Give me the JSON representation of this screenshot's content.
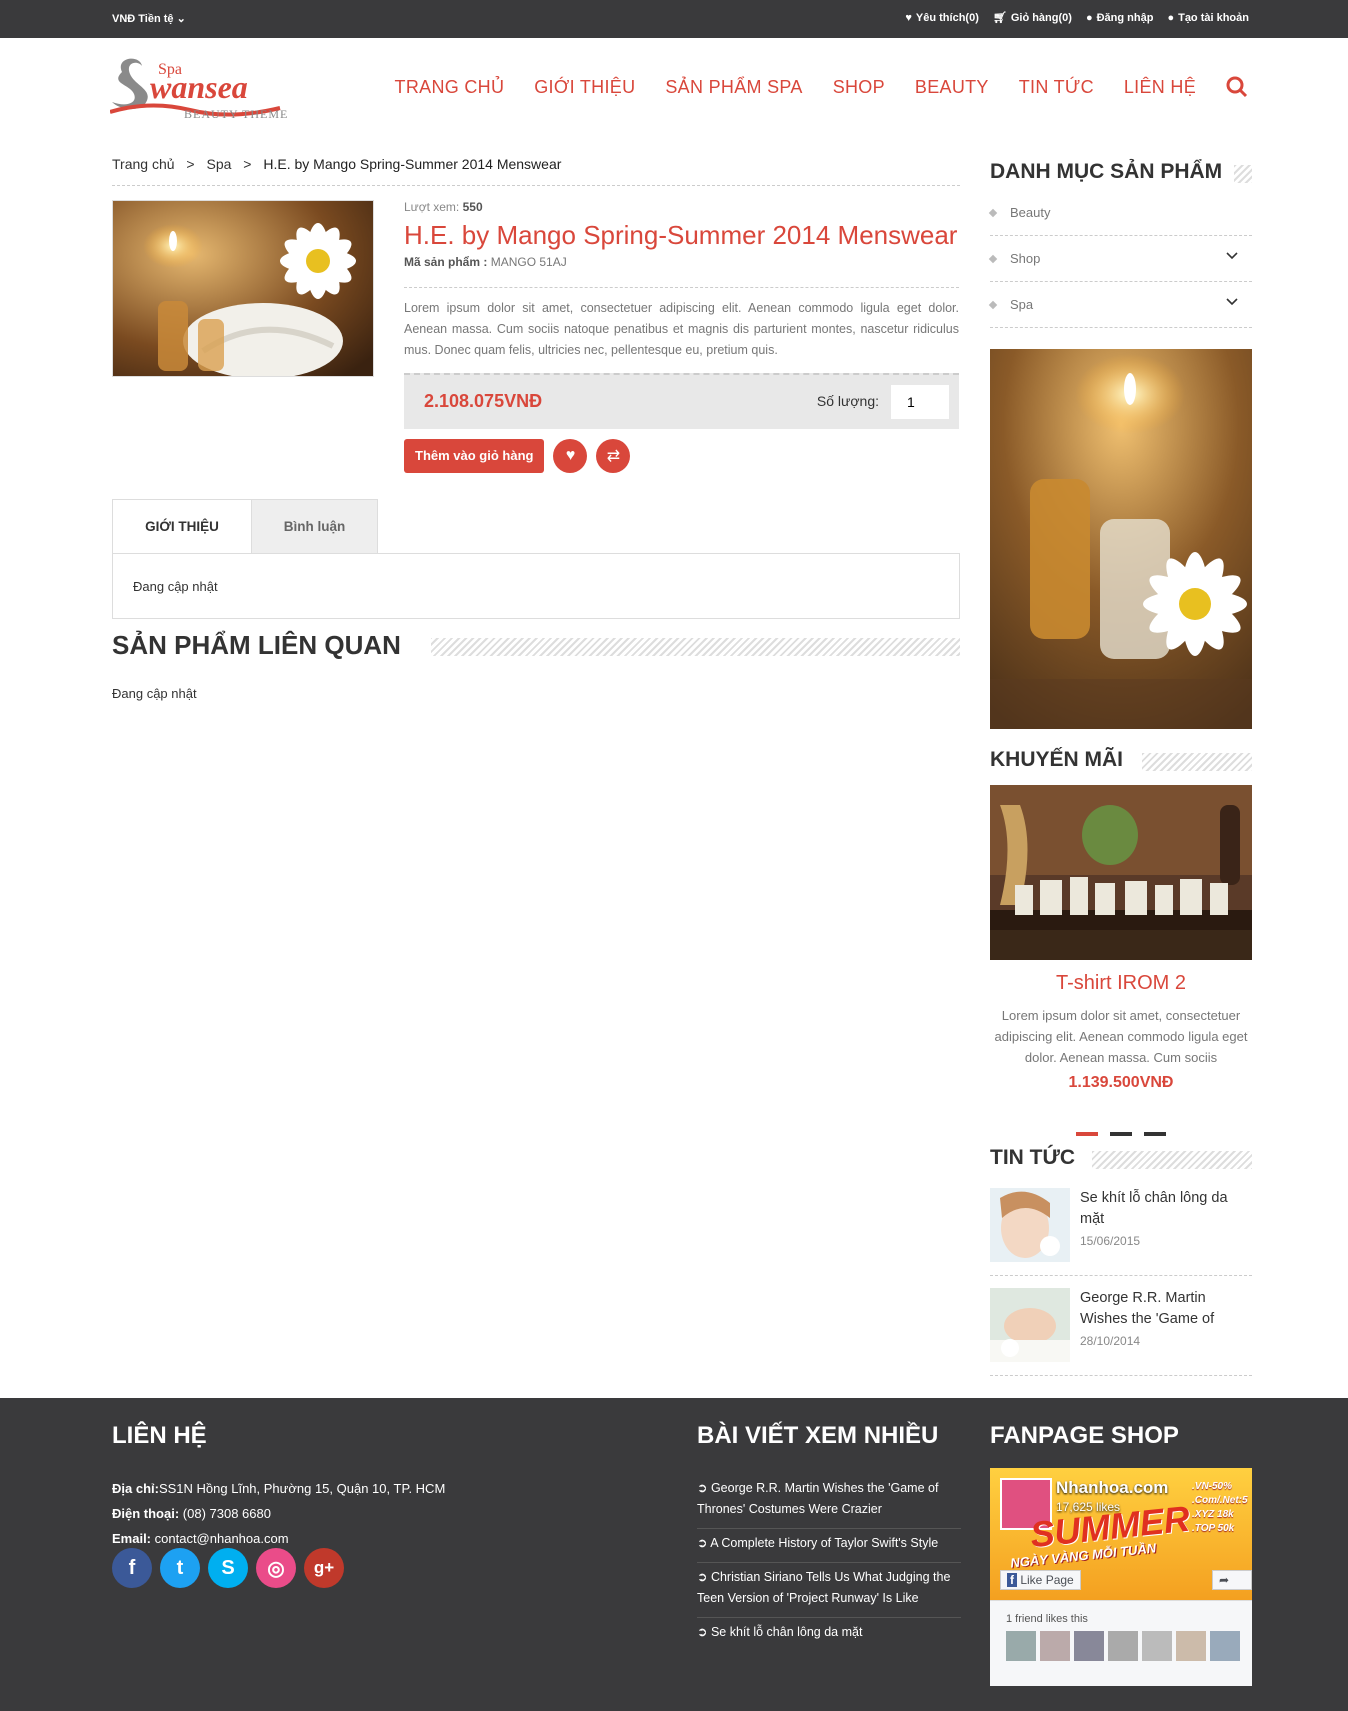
{
  "topbar": {
    "currency": "VNĐ Tiền tệ",
    "wishlist": "Yêu thích(0)",
    "cart": "Giỏ hàng(0)",
    "login": "Đăng nhập",
    "register": "Tạo tài khoản"
  },
  "logo": {
    "spa": "Spa",
    "name": "wansea",
    "tagline": "BEAUTY THEME"
  },
  "nav": [
    "TRANG CHỦ",
    "GIỚI THIỆU",
    "SẢN PHẨM SPA",
    "SHOP",
    "BEAUTY",
    "TIN TỨC",
    "LIÊN HỆ"
  ],
  "breadcrumb": {
    "home": "Trang chủ",
    "sep": ">",
    "cat": "Spa",
    "current": "H.E. by Mango Spring-Summer 2014 Menswear"
  },
  "product": {
    "views_label": "Lượt xem:",
    "views": "550",
    "title": "H.E. by Mango Spring-Summer 2014 Menswear",
    "sku_label": "Mã sản phẩm :",
    "sku": "MANGO 51AJ",
    "description": "Lorem ipsum dolor sit amet, consectetuer adipiscing elit. Aenean commodo ligula eget dolor. Aenean massa. Cum sociis natoque penatibus et magnis dis parturient montes, nascetur ridiculus mus. Donec quam felis, ultricies nec, pellentesque eu, pretium quis.",
    "price": "2.108.075VNĐ",
    "qty_label": "Số lượng:",
    "qty": "1",
    "add_to_cart": "Thêm vào giỏ hàng"
  },
  "tabs": {
    "intro": "GIỚI THIỆU",
    "comments": "Bình luận",
    "body": "Đang cập nhật"
  },
  "related": {
    "title": "SẢN PHẨM LIÊN QUAN",
    "body": "Đang cập nhật"
  },
  "sidebar": {
    "categories_title": "DANH MỤC SẢN PHẨM",
    "categories": [
      "Beauty",
      "Shop",
      "Spa"
    ],
    "promo_title": "KHUYẾN MÃI",
    "promo": {
      "name": "T-shirt IROM 2",
      "desc": "Lorem ipsum dolor sit amet, consectetuer adipiscing elit. Aenean commodo ligula eget dolor. Aenean massa. Cum sociis",
      "price": "1.139.500VNĐ"
    },
    "news_title": "TIN TỨC",
    "news": [
      {
        "title": "Se khít lỗ chân lông da mặt",
        "date": "15/06/2015"
      },
      {
        "title": "George R.R. Martin Wishes the 'Game of",
        "date": "28/10/2014"
      }
    ]
  },
  "footer": {
    "contact_title": "LIÊN HỆ",
    "address_label": "Địa chỉ:",
    "address": "SS1N Hồng Lĩnh, Phường 15, Quận 10, TP. HCM",
    "phone_label": "Điện thoại:",
    "phone": "(08) 7308 6680",
    "email_label": "Email:",
    "email": "contact@nhanhoa.com",
    "posts_title": "BÀI VIẾT XEM NHIỀU",
    "posts": [
      "George R.R. Martin Wishes the 'Game of Thrones' Costumes Were Crazier",
      "A Complete History of Taylor Swift's Style",
      "Christian Siriano Tells Us What Judging the Teen Version of 'Project Runway' Is Like",
      "Se khít lỗ chân lông da mặt"
    ],
    "fanpage_title": "FANPAGE SHOP",
    "fb": {
      "name": "Nhanhoa.com",
      "likes": "17,625 likes",
      "like_btn": "Like Page",
      "friends": "1 friend likes this",
      "banner": "SUMMER",
      "banner_sub": "NGÀY VÀNG MỖI TUẦN",
      "domains": [
        ".VN-50%",
        ".Com/.Net:5",
        ".XYZ 18k",
        ".TOP 50k"
      ]
    }
  },
  "colors": {
    "accent": "#d9473b",
    "dark": "#3a3a3c"
  }
}
